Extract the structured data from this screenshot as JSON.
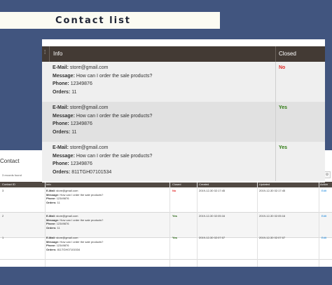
{
  "page_title": "Contact list",
  "admin": {
    "title": "Contact",
    "records_found": "3 records found",
    "columns": [
      "Contact ID",
      "Info",
      "Closed",
      "Created",
      "Updated",
      "Action"
    ],
    "rows": [
      {
        "id": "3",
        "email": "store@gmail.com",
        "message": "How can I order the sale products?",
        "phone": "12349876",
        "orders": "11",
        "closed": "No",
        "created": "2019-12-30 02:17:45",
        "updated": "2019-12-30 02:17:45",
        "action": "Edit"
      },
      {
        "id": "2",
        "email": "store@gmail.com",
        "message": "How can I order the sale products?",
        "phone": "12349876",
        "orders": "11",
        "closed": "Yes",
        "created": "2019-12-30 02:05:16",
        "updated": "2019-12-30 02:05:16",
        "action": "Edit"
      },
      {
        "id": "1",
        "email": "store@gmail.com",
        "message": "How can I order the sale products?",
        "phone": "12349876",
        "orders": "811TGH07101534",
        "closed": "Yes",
        "created": "2019-12-30 02:07:07",
        "updated": "2019-12-30 02:07:07",
        "action": "Edit"
      }
    ]
  },
  "list": {
    "col_info": "Info",
    "col_closed": "Closed",
    "labels": {
      "email": "E-Mail:",
      "message": "Message:",
      "phone": "Phone:",
      "orders": "Orders:"
    },
    "rows": [
      {
        "email": "store@gmail.com",
        "message": "How can I order the sale products?",
        "phone": "12349876",
        "orders": "11",
        "closed": "No"
      },
      {
        "email": "store@gmail.com",
        "message": "How can I order the sale products?",
        "phone": "12349876",
        "orders": "11",
        "closed": "Yes"
      },
      {
        "email": "store@gmail.com",
        "message": "How can I order the sale products?",
        "phone": "12349876",
        "orders": "811TGH07101534",
        "closed": "Yes"
      }
    ]
  },
  "colors": {
    "background": "#41557f",
    "header": "#433a34",
    "no": "#e02b27",
    "yes": "#2d7a10"
  }
}
